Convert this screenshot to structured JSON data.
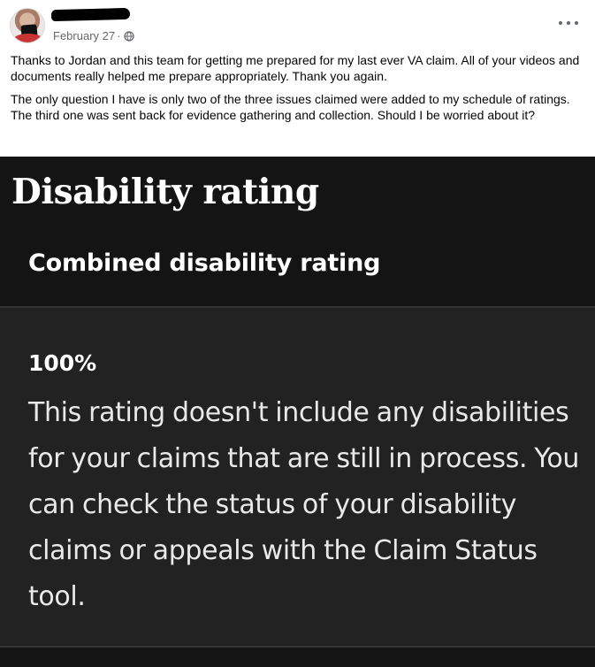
{
  "post": {
    "author_name": "",
    "date": "February 27",
    "separator": "·",
    "privacy_icon": "globe-icon",
    "more_options_icon": "more-horizontal-icon",
    "paragraphs": [
      "Thanks to Jordan and this team for getting me prepared for my last ever VA claim. All of your videos and documents really helped me prepare appropriately. Thank you again.",
      "The only question I have is only two of the three issues claimed were added to my schedule of ratings. The third one was sent back for evidence gathering and collection. Should I be worried about it?"
    ]
  },
  "image": {
    "title": "Disability rating",
    "section_heading": "Combined disability rating",
    "rating_value": "100%",
    "rating_description": "This rating doesn't include any disabilities for your claims that are still in process. You can check the status of your disability claims or appeals with the Claim Status tool."
  },
  "colors": {
    "page_background": "#ffffff",
    "text_primary": "#050505",
    "text_secondary": "#65676b",
    "image_background": "#141414",
    "panel_background": "#222222",
    "image_text": "#ffffff"
  }
}
